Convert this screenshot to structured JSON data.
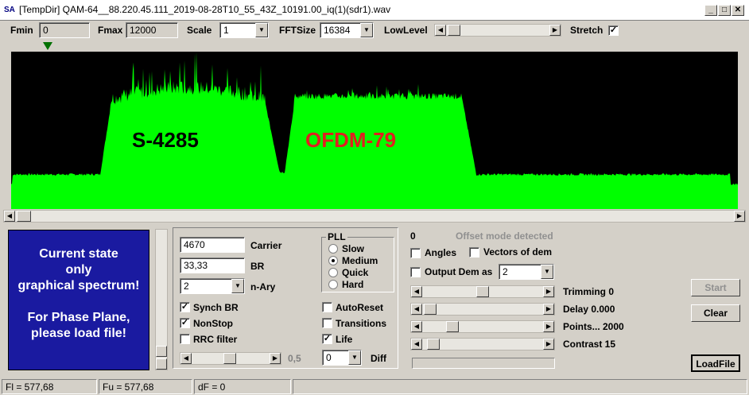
{
  "window": {
    "icon": "SA",
    "title": "[TempDir] QAM-64__88.220.45.111_2019-08-28T10_55_43Z_10191.00_iq(1)(sdr1).wav",
    "controls": [
      "_",
      "□",
      "✕"
    ]
  },
  "toolbar": {
    "fmin_label": "Fmin",
    "fmin_value": "0",
    "fmax_label": "Fmax",
    "fmax_value": "12000",
    "scale_label": "Scale",
    "scale_value": "1",
    "fftsize_label": "FFTSize",
    "fftsize_value": "16384",
    "lowlevel_label": "LowLevel",
    "stretch_label": "Stretch",
    "stretch_checked": true
  },
  "spectrum": {
    "labels": [
      {
        "text": "S-4285",
        "color": "#000000"
      },
      {
        "text": "OFDM-79",
        "color": "#e02020"
      }
    ],
    "color": "#00ff00"
  },
  "state_box": {
    "lines": [
      "Current state",
      "only",
      "graphical spectrum!",
      "",
      "For Phase Plane,",
      "please load file!"
    ]
  },
  "params": {
    "carrier_value": "4670",
    "carrier_label": "Carrier",
    "br_value": "33,33",
    "br_label": "BR",
    "nary_value": "2",
    "nary_label": "n-Ary",
    "synch_br_label": "Synch BR",
    "synch_br_checked": true,
    "nonstop_label": "NonStop",
    "nonstop_checked": true,
    "rrc_label": "RRC filter",
    "rrc_checked": false,
    "slider_value": "0,5"
  },
  "pll": {
    "title": "PLL",
    "options": [
      "Slow",
      "Medium",
      "Quick",
      "Hard"
    ],
    "selected": "Medium"
  },
  "right_checks": {
    "autoreset_label": "AutoReset",
    "transitions_label": "Transitions",
    "life_label": "Life",
    "life_checked": true,
    "diff_value": "0",
    "diff_label": "Diff"
  },
  "demod": {
    "count": "0",
    "offset_status": "Offset mode detected",
    "angles_label": "Angles",
    "vectors_label": "Vectors of dem",
    "output_label": "Output Dem as",
    "output_value": "2",
    "trimming_label": "Trimming 0",
    "delay_label": "Delay  0.000",
    "points_label": "Points... 2000",
    "contrast_label": "Contrast 15"
  },
  "buttons": {
    "start": "Start",
    "clear": "Clear",
    "loadfile": "LoadFile"
  },
  "status": {
    "fl": "Fl = 577,68",
    "fu": "Fu = 577,68",
    "df": "dF = 0"
  }
}
